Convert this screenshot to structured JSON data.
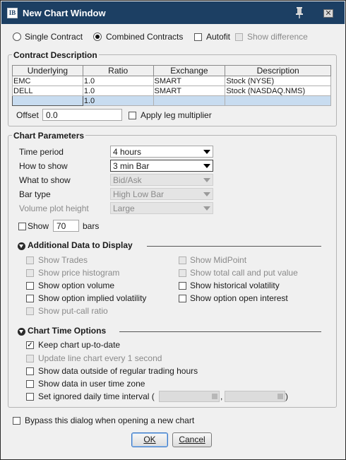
{
  "window": {
    "title": "New Chart Window",
    "logo": "IB"
  },
  "mode": {
    "single_label": "Single Contract",
    "combined_label": "Combined Contracts",
    "autofit_label": "Autofit",
    "show_difference_label": "Show difference",
    "selected": "combined"
  },
  "contract": {
    "title": "Contract Description",
    "columns": [
      "Underlying",
      "Ratio",
      "Exchange",
      "Description"
    ],
    "rows": [
      [
        "EMC",
        "1.0",
        "SMART",
        "Stock (NYSE)"
      ],
      [
        "DELL",
        "1.0",
        "SMART",
        "Stock (NASDAQ.NMS)"
      ],
      [
        "",
        "1.0",
        "",
        ""
      ]
    ],
    "offset_label": "Offset",
    "offset_value": "0.0",
    "leg_multiplier_label": "Apply leg multiplier"
  },
  "params": {
    "title": "Chart Parameters",
    "time_period_label": "Time period",
    "time_period_value": "4 hours",
    "how_to_show_label": "How to show",
    "how_to_show_value": "3 min Bar",
    "what_to_show_label": "What to show",
    "what_to_show_value": "Bid/Ask",
    "bar_type_label": "Bar type",
    "bar_type_value": "High Low Bar",
    "volume_plot_label": "Volume plot height",
    "volume_plot_value": "Large",
    "show_label": "Show",
    "bars_value": "70",
    "bars_label": "bars"
  },
  "additional": {
    "title": "Additional Data to Display",
    "left": [
      {
        "label": "Show Trades",
        "enabled": false
      },
      {
        "label": "Show price histogram",
        "enabled": false
      },
      {
        "label": "Show option volume",
        "enabled": true
      },
      {
        "label": "Show option implied volatility",
        "enabled": true
      },
      {
        "label": "Show put-call ratio",
        "enabled": false
      }
    ],
    "right": [
      {
        "label": "Show MidPoint",
        "enabled": false
      },
      {
        "label": "Show total call and put value",
        "enabled": false
      },
      {
        "label": "Show historical volatility",
        "enabled": true
      },
      {
        "label": "Show option open interest",
        "enabled": true
      }
    ]
  },
  "time_options": {
    "title": "Chart Time Options",
    "items": [
      {
        "label": "Keep chart up-to-date",
        "checked": true,
        "enabled": true
      },
      {
        "label": "Update line chart every 1 second",
        "checked": false,
        "enabled": false
      },
      {
        "label": "Show data outside of regular trading hours",
        "checked": false,
        "enabled": true
      },
      {
        "label": "Show data in user time zone",
        "checked": false,
        "enabled": true
      },
      {
        "label": "Set ignored daily time interval (",
        "checked": false,
        "enabled": true
      }
    ],
    "separator": ",",
    "close_paren": ")"
  },
  "footer": {
    "bypass_label": "Bypass this dialog when opening a new chart",
    "ok_label": "OK",
    "cancel_label": "Cancel"
  }
}
